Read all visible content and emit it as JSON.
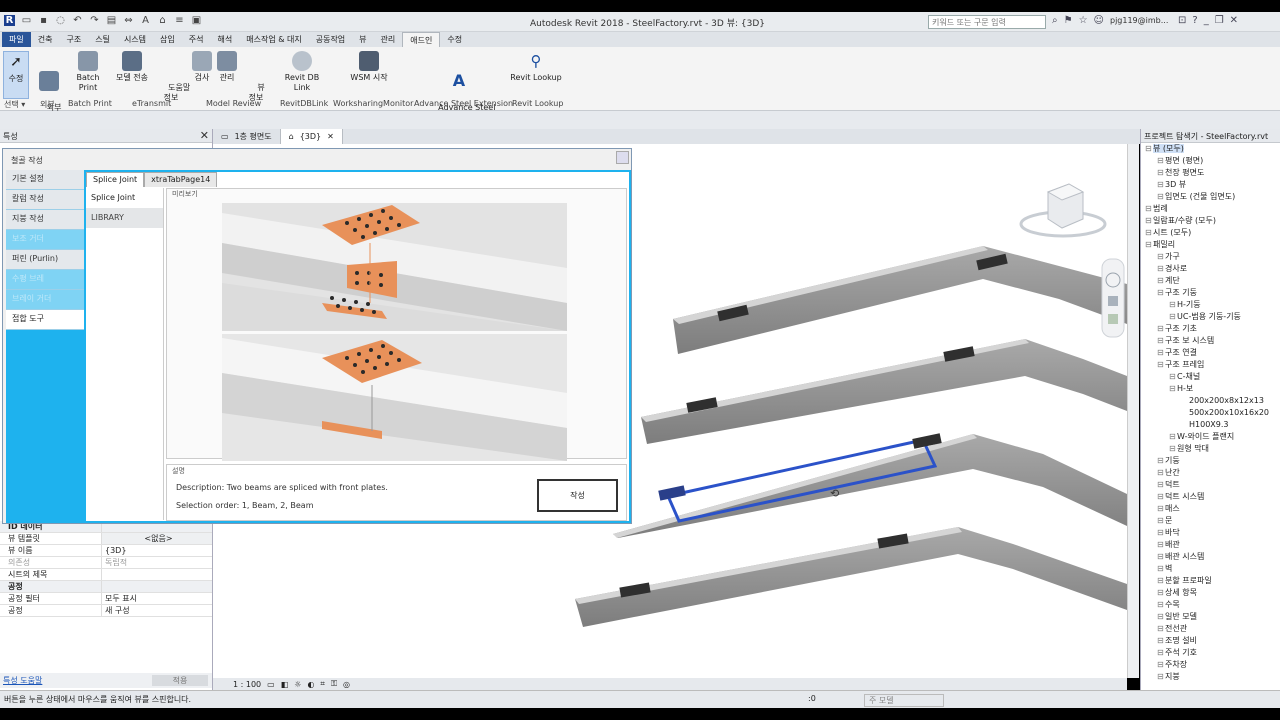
{
  "app": {
    "title": "Autodesk Revit 2018 - SteelFactory.rvt - 3D 뷰: {3D}",
    "search_placeholder": "키워드 또는 구문 입력",
    "user": "pjg119@imb..."
  },
  "menu_tabs": [
    "파일",
    "건축",
    "구조",
    "스틸",
    "시스템",
    "삽입",
    "주석",
    "해석",
    "매스작업 & 대지",
    "공동작업",
    "뷰",
    "관리",
    "애드인",
    "수정"
  ],
  "ribbon": {
    "buttons": [
      "수정",
      "외부\n도구",
      "Batch Print",
      "모델 전송",
      "도움말\n정보",
      "검사",
      "관리",
      "뷰\n정보",
      "Revit DB Link",
      "WSM 시작",
      "Advance Steel\nExtension",
      "Revit Lookup"
    ],
    "panels": [
      "선택 ▾",
      "외부",
      "Batch Print",
      "eTransmit",
      "Model Review",
      "RevitDBLink",
      "WorksharingMonitor",
      "Advance Steel Extension",
      "Revit Lookup"
    ]
  },
  "properties": {
    "title": "특성",
    "rows": [
      {
        "k": "ID 데이터",
        "v": "",
        "section": true
      },
      {
        "k": "뷰 템플릿",
        "v": "<없음>"
      },
      {
        "k": "뷰 이름",
        "v": "{3D}"
      },
      {
        "k": "의존성",
        "v": "독립적",
        "dim": true
      },
      {
        "k": "시트의 제목",
        "v": ""
      },
      {
        "k": "공정",
        "v": "",
        "section": true
      },
      {
        "k": "공정 필터",
        "v": "모두 표시"
      },
      {
        "k": "공정",
        "v": "새 구성"
      }
    ],
    "help_link": "특성 도움말",
    "apply": "적용"
  },
  "view_tabs": [
    "1층 평면도",
    "{3D}"
  ],
  "dialog": {
    "title": "철골 작성",
    "side_buttons": [
      "기본 설정",
      "칼럼 작성",
      "지붕 작성",
      "보조 거더",
      "퍼린 (Purlin)",
      "수평 브레",
      "브레이 거더",
      "접합 도구"
    ],
    "tabs": [
      "Splice Joint",
      "xtraTabPage14"
    ],
    "list": [
      "Splice Joint",
      "LIBRARY"
    ],
    "preview_label": "미리보기",
    "desc_label": "설명",
    "description": "Description: Two beams are spliced with front plates.",
    "selection_order": "Selection order: 1, Beam, 2, Beam",
    "create_label": "작성"
  },
  "browser": {
    "title": "프로젝트 탐색기 - SteelFactory.rvt",
    "nodes": [
      {
        "t": "뷰 (모두)",
        "d": 0,
        "sel": true
      },
      {
        "t": "평면 (평면)",
        "d": 1
      },
      {
        "t": "천장 평면도",
        "d": 1
      },
      {
        "t": "3D 뷰",
        "d": 1
      },
      {
        "t": "입면도 (건물 입면도)",
        "d": 1
      },
      {
        "t": "범례",
        "d": 0
      },
      {
        "t": "일람표/수량 (모두)",
        "d": 0
      },
      {
        "t": "시트 (모두)",
        "d": 0
      },
      {
        "t": "패밀리",
        "d": 0
      },
      {
        "t": "가구",
        "d": 1
      },
      {
        "t": "경사로",
        "d": 1
      },
      {
        "t": "계단",
        "d": 1
      },
      {
        "t": "구조 기둥",
        "d": 1
      },
      {
        "t": "H-기둥",
        "d": 2
      },
      {
        "t": "UC-범용 기둥-기둥",
        "d": 2
      },
      {
        "t": "구조 기초",
        "d": 1
      },
      {
        "t": "구조 보 시스템",
        "d": 1
      },
      {
        "t": "구조 연결",
        "d": 1
      },
      {
        "t": "구조 프레임",
        "d": 1
      },
      {
        "t": "C-채널",
        "d": 2
      },
      {
        "t": "H-보",
        "d": 2
      },
      {
        "t": "200x200x8x12x13",
        "d": 3
      },
      {
        "t": "500x200x10x16x20",
        "d": 3
      },
      {
        "t": "H100X9.3",
        "d": 3
      },
      {
        "t": "W-와이드 플랜지",
        "d": 2
      },
      {
        "t": "원형 막대",
        "d": 2
      },
      {
        "t": "기둥",
        "d": 1
      },
      {
        "t": "난간",
        "d": 1
      },
      {
        "t": "덕트",
        "d": 1
      },
      {
        "t": "덕트 시스템",
        "d": 1
      },
      {
        "t": "매스",
        "d": 1
      },
      {
        "t": "문",
        "d": 1
      },
      {
        "t": "바닥",
        "d": 1
      },
      {
        "t": "배관",
        "d": 1
      },
      {
        "t": "배관 시스템",
        "d": 1
      },
      {
        "t": "벽",
        "d": 1
      },
      {
        "t": "분할 프로파일",
        "d": 1
      },
      {
        "t": "상세 항목",
        "d": 1
      },
      {
        "t": "수목",
        "d": 1
      },
      {
        "t": "일반 모델",
        "d": 1
      },
      {
        "t": "전선관",
        "d": 1
      },
      {
        "t": "조명 설비",
        "d": 1
      },
      {
        "t": "주석 기호",
        "d": 1
      },
      {
        "t": "주차장",
        "d": 1
      },
      {
        "t": "지붕",
        "d": 1
      }
    ]
  },
  "view_control": {
    "scale": "1 : 100"
  },
  "status": {
    "text": "버튼을 누른 상태에서 마우스를 움직여 뷰를 스핀합니다.",
    "main_model": "주 모델",
    "count0": ":0"
  },
  "colors": {
    "accent_blue": "#1eb2ee",
    "file_tab": "#2a5599",
    "plate": "#e8915a",
    "beam": "#8e8e8e",
    "selection": "#2b52c9"
  }
}
